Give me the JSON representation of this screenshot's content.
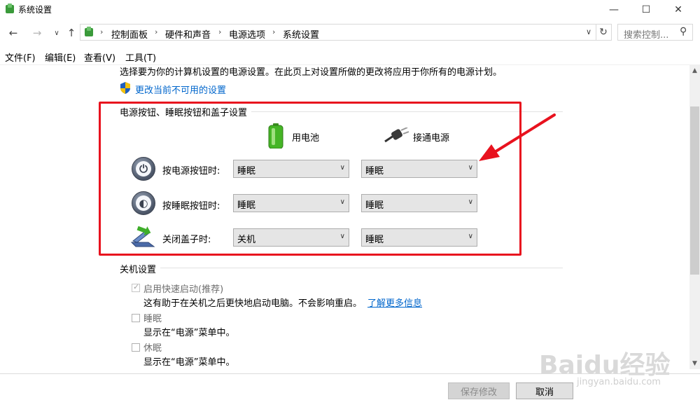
{
  "window": {
    "title": "系统设置"
  },
  "toolbar": {
    "breadcrumb": [
      "控制面板",
      "硬件和声音",
      "电源选项",
      "系统设置"
    ],
    "search_placeholder": "搜索控制..."
  },
  "menu": [
    "文件(F)",
    "编辑(E)",
    "查看(V)",
    "工具(T)"
  ],
  "content": {
    "description": "选择要为你的计算机设置的电源设置。在此页上对设置所做的更改将应用于你所有的电源计划。",
    "change_link": "更改当前不可用的设置",
    "power_section": {
      "title": "电源按钮、睡眠按钮和盖子设置",
      "col_battery": "用电池",
      "col_plugged": "接通电源",
      "rows": [
        {
          "label": "按电源按钮时:",
          "battery": "睡眠",
          "plugged": "睡眠",
          "icon": "power-button-icon"
        },
        {
          "label": "按睡眠按钮时:",
          "battery": "睡眠",
          "plugged": "睡眠",
          "icon": "sleep-button-icon"
        },
        {
          "label": "关闭盖子时:",
          "battery": "关机",
          "plugged": "睡眠",
          "icon": "laptop-lid-icon"
        }
      ]
    },
    "shutdown_section": {
      "title": "关机设置",
      "items": [
        {
          "label": "启用快速启动(推荐)",
          "checked": true,
          "disabled": true,
          "desc": "这有助于在关机之后更快地启动电脑。不会影响重启。",
          "link": "了解更多信息"
        },
        {
          "label": "睡眠",
          "checked": false,
          "desc": "显示在“电源”菜单中。"
        },
        {
          "label": "休眠",
          "checked": false,
          "desc": "显示在“电源”菜单中。"
        }
      ]
    }
  },
  "buttons": {
    "save": "保存修改",
    "cancel": "取消"
  },
  "watermark": {
    "brand": "Baidu经验",
    "url": "jingyan.baidu.com"
  },
  "colors": {
    "annotation_red": "#e8121e",
    "link_blue": "#0066cc"
  }
}
